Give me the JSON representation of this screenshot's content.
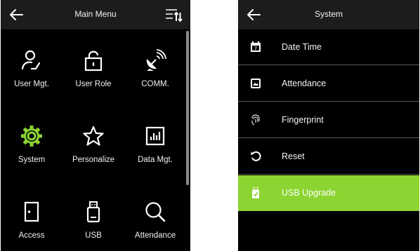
{
  "main_menu": {
    "title": "Main Menu",
    "back_icon": "back-arrow-icon",
    "sort_icon": "sort-menu-icon",
    "items": [
      {
        "label": "User Mgt.",
        "icon": "user-icon"
      },
      {
        "label": "User Role",
        "icon": "lock-icon"
      },
      {
        "label": "COMM.",
        "icon": "satellite-dish-icon"
      },
      {
        "label": "System",
        "icon": "gear-icon",
        "color": "#8bd431"
      },
      {
        "label": "Personalize",
        "icon": "star-icon"
      },
      {
        "label": "Data Mgt.",
        "icon": "bar-chart-icon"
      },
      {
        "label": "Access",
        "icon": "door-icon"
      },
      {
        "label": "USB",
        "icon": "usb-icon"
      },
      {
        "label": "Attendance",
        "icon": "magnifier-icon"
      }
    ]
  },
  "system_menu": {
    "title": "System",
    "back_icon": "back-arrow-icon",
    "items": [
      {
        "label": "Date Time",
        "icon": "calendar-icon"
      },
      {
        "label": "Attendance",
        "icon": "picture-icon"
      },
      {
        "label": "Fingerprint",
        "icon": "fingerprint-icon"
      },
      {
        "label": "Reset",
        "icon": "reset-icon"
      },
      {
        "label": "USB Upgrade",
        "icon": "usb-drive-icon",
        "selected": true
      }
    ]
  },
  "colors": {
    "accent": "#8bd431",
    "background": "#000000",
    "header": "#1c1c1c",
    "separator": "#5a5a5a"
  }
}
